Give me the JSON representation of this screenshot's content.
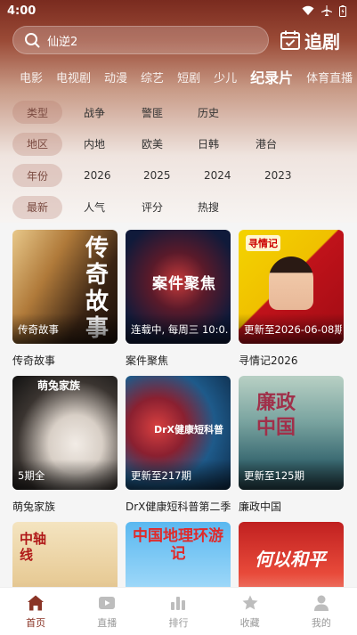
{
  "status": {
    "time": "4:00"
  },
  "search": {
    "value": "仙逆2",
    "follow_label": "追剧"
  },
  "tabs": [
    {
      "label": "电影"
    },
    {
      "label": "电视剧"
    },
    {
      "label": "动漫"
    },
    {
      "label": "综艺"
    },
    {
      "label": "短剧"
    },
    {
      "label": "少儿"
    },
    {
      "label": "纪录片",
      "active": true
    },
    {
      "label": "体育直播"
    }
  ],
  "filters": [
    {
      "label": "类型",
      "options": [
        "战争",
        "警匪",
        "历史"
      ]
    },
    {
      "label": "地区",
      "options": [
        "内地",
        "欧美",
        "日韩",
        "港台"
      ]
    },
    {
      "label": "年份",
      "options": [
        "2026",
        "2025",
        "2024",
        "2023"
      ]
    },
    {
      "label": "最新",
      "options": [
        "人气",
        "评分",
        "热搜"
      ]
    }
  ],
  "cards": [
    {
      "title": "传奇故事",
      "badge": "传奇故事",
      "art": "传奇故事"
    },
    {
      "title": "案件聚焦",
      "badge": "连载中, 每周三 10:0...",
      "art": "案件聚焦"
    },
    {
      "title": "寻情记2026",
      "badge": "更新至2026-06-08期",
      "art": "寻情记"
    },
    {
      "title": "萌兔家族",
      "badge": "5期全",
      "art": "萌兔家族"
    },
    {
      "title": "DrX健康短科普第二季",
      "badge": "更新至217期",
      "art": "DrX健康短科普"
    },
    {
      "title": "廉政中国",
      "badge": "更新至125期",
      "art": "廉政中国"
    },
    {
      "title": "",
      "badge": "",
      "art": "中轴线"
    },
    {
      "title": "",
      "badge": "",
      "art": "中国地理环游记"
    },
    {
      "title": "",
      "badge": "",
      "art": "何以和平"
    }
  ],
  "nav": [
    {
      "label": "首页",
      "icon": "home-icon",
      "active": true
    },
    {
      "label": "直播",
      "icon": "tv-icon"
    },
    {
      "label": "排行",
      "icon": "chart-icon"
    },
    {
      "label": "收藏",
      "icon": "star-icon"
    },
    {
      "label": "我的",
      "icon": "user-icon"
    }
  ],
  "colors": {
    "accent": "#8a3426",
    "hero_top": "#7a2b1f"
  }
}
